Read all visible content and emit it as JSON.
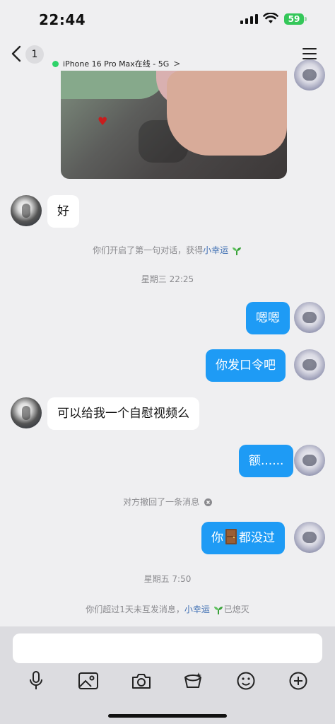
{
  "status_bar": {
    "time": "22:44",
    "battery": "59"
  },
  "header": {
    "unread_count": "1",
    "online_status": "iPhone 16 Pro Max在线 - 5G",
    "online_chevron": ">"
  },
  "messages": {
    "m1": "好",
    "m2": "嗯嗯",
    "m3": "你发口令吧",
    "m4": "可以给我一个自慰视频么",
    "m5": "额......",
    "m6_before": "你",
    "m6_after": "都没过"
  },
  "system": {
    "first_chat_prefix": "你们开启了第一句对话，获得",
    "lucky_name": "小幸运",
    "timestamp1": "星期三 22:25",
    "recalled": "对方撤回了一条消息",
    "timestamp2": "星期五 7:50",
    "expired_prefix": "你们超过1天未互发消息，",
    "expired_suffix": "已熄灭"
  },
  "input": {
    "placeholder": ""
  },
  "icons": [
    "back-icon",
    "menu-icon",
    "mic-icon",
    "image-icon",
    "camera-icon",
    "red-packet-icon",
    "emoji-icon",
    "plus-icon",
    "door-emoji-icon",
    "sprout-icon",
    "info-icon"
  ],
  "colors": {
    "outgoing_bubble": "#1e9bf5",
    "online_dot": "#2fd36a",
    "battery": "#34c759",
    "link": "#3f6fb3"
  }
}
